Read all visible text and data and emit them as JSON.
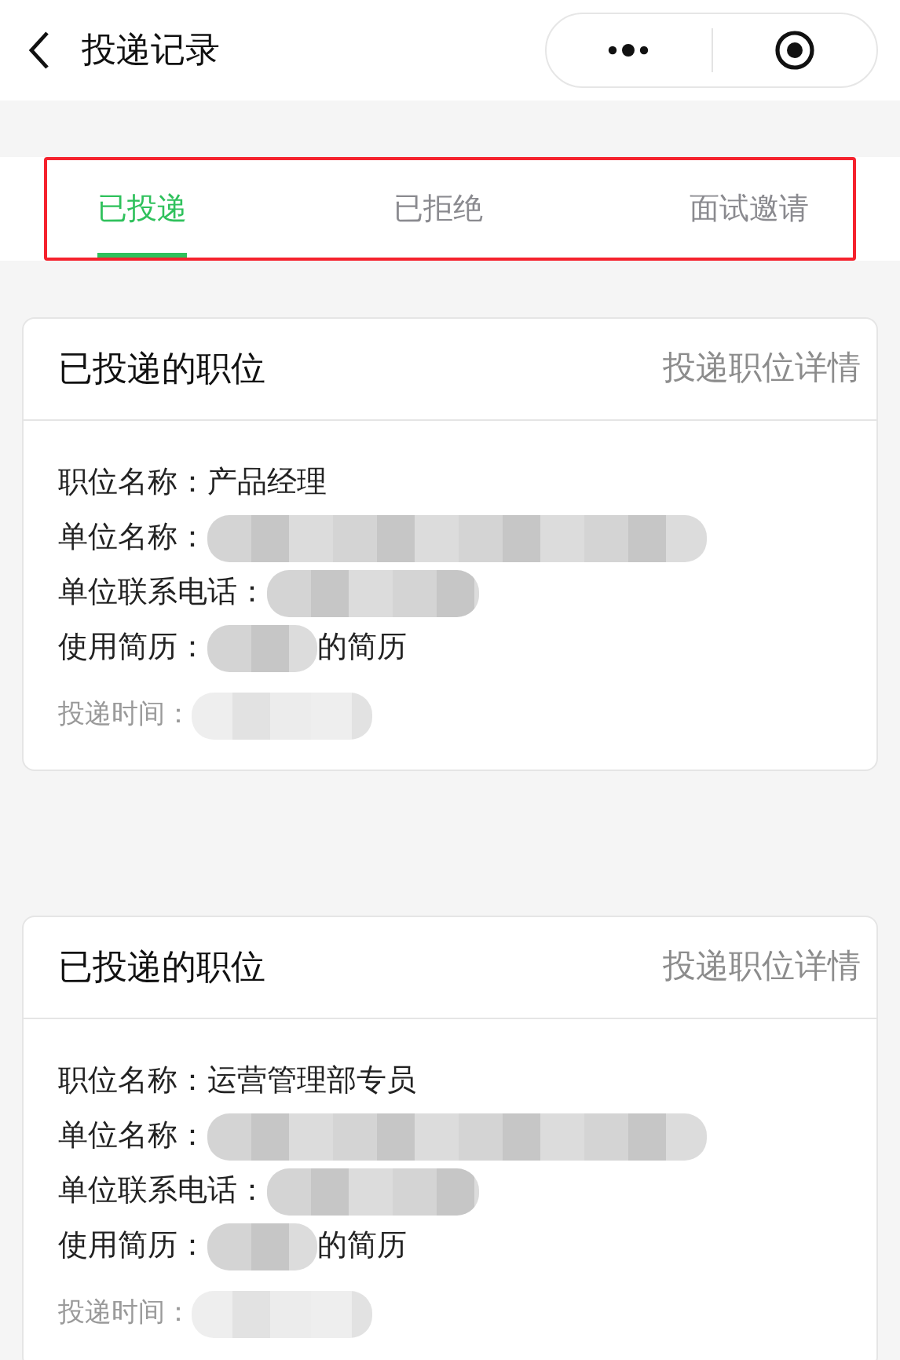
{
  "nav": {
    "title": "投递记录"
  },
  "tabs": {
    "highlight": true,
    "items": [
      {
        "label": "已投递",
        "selected": true
      },
      {
        "label": "已拒绝",
        "selected": false
      },
      {
        "label": "面试邀请",
        "selected": false
      }
    ]
  },
  "cards": [
    {
      "title": "已投递的职位",
      "link": "投递职位详情",
      "fields": [
        {
          "label": "职位名称：",
          "value": "产品经理"
        },
        {
          "label": "单位名称：",
          "redacted": true
        },
        {
          "label": "单位联系电话：",
          "redacted": true
        },
        {
          "label": "使用简历：",
          "redacted": true,
          "suffix": "的简历"
        }
      ],
      "time": {
        "label": "投递时间：",
        "redacted": true
      }
    },
    {
      "title": "已投递的职位",
      "link": "投递职位详情",
      "fields": [
        {
          "label": "职位名称：",
          "value": "运营管理部专员"
        },
        {
          "label": "单位名称：",
          "redacted": true
        },
        {
          "label": "单位联系电话：",
          "redacted": true
        },
        {
          "label": "使用简历：",
          "redacted": true,
          "suffix": "的简历"
        }
      ],
      "time": {
        "label": "投递时间：",
        "redacted": true
      }
    }
  ]
}
